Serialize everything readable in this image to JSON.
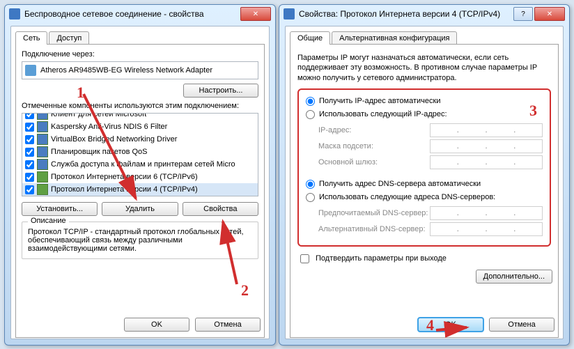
{
  "win1": {
    "title": "Беспроводное сетевое соединение - свойства",
    "tabs": [
      "Сеть",
      "Доступ"
    ],
    "connect_label": "Подключение через:",
    "adapter": "Atheros AR9485WB-EG Wireless Network Adapter",
    "configure": "Настроить...",
    "components_label": "Отмеченные компоненты используются этим подключением:",
    "items": [
      {
        "label": "Клиент для сетей Microsoft",
        "checked": true,
        "icon": "mon"
      },
      {
        "label": "Kaspersky Anti-Virus NDIS 6 Filter",
        "checked": true,
        "icon": "mon"
      },
      {
        "label": "VirtualBox Bridged Networking Driver",
        "checked": true,
        "icon": "mon"
      },
      {
        "label": "Планировщик пакетов QoS",
        "checked": true,
        "icon": "mon"
      },
      {
        "label": "Служба доступа к файлам и принтерам сетей Micro",
        "checked": true,
        "icon": "mon"
      },
      {
        "label": "Протокол Интернета версии 6 (TCP/IPv6)",
        "checked": true,
        "icon": "proto"
      },
      {
        "label": "Протокол Интернета версии 4 (TCP/IPv4)",
        "checked": true,
        "icon": "proto"
      }
    ],
    "install": "Установить...",
    "remove": "Удалить",
    "properties": "Свойства",
    "desc_label": "Описание",
    "desc": "Протокол TCP/IP - стандартный протокол глобальных сетей, обеспечивающий связь между различными взаимодействующими сетями.",
    "ok": "OK",
    "cancel": "Отмена"
  },
  "win2": {
    "title": "Свойства: Протокол Интернета версии 4 (TCP/IPv4)",
    "tabs": [
      "Общие",
      "Альтернативная конфигурация"
    ],
    "desc": "Параметры IP могут назначаться автоматически, если сеть поддерживает эту возможность. В противном случае параметры IP можно получить у сетевого администратора.",
    "ip_auto": "Получить IP-адрес автоматически",
    "ip_manual": "Использовать следующий IP-адрес:",
    "ip_label": "IP-адрес:",
    "mask_label": "Маска подсети:",
    "gw_label": "Основной шлюз:",
    "dns_auto": "Получить адрес DNS-сервера автоматически",
    "dns_manual": "Использовать следующие адреса DNS-серверов:",
    "dns1_label": "Предпочитаемый DNS-сервер:",
    "dns2_label": "Альтернативный DNS-сервер:",
    "validate": "Подтвердить параметры при выходе",
    "advanced": "Дополнительно...",
    "ok": "OK",
    "cancel": "Отмена"
  },
  "annotations": {
    "n1": "1",
    "n2": "2",
    "n3": "3",
    "n4": "4"
  }
}
